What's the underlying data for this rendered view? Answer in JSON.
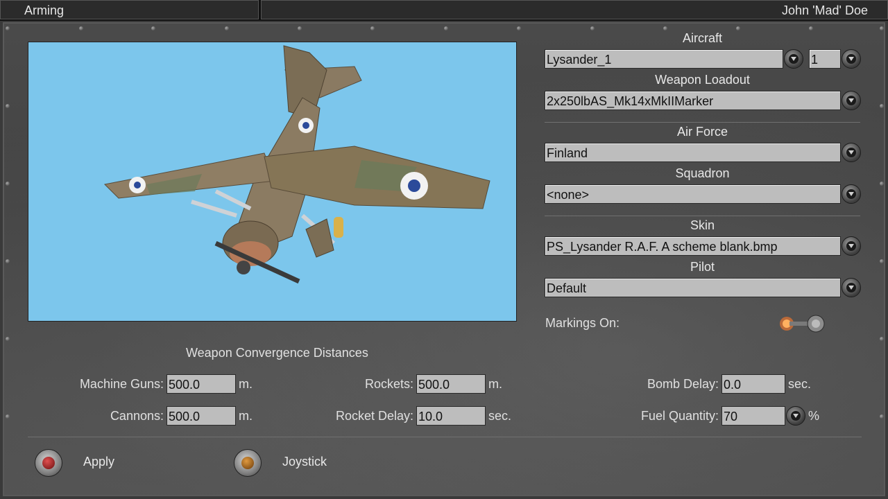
{
  "titlebar": {
    "title": "Arming",
    "user": "John 'Mad' Doe"
  },
  "aircraft": {
    "label": "Aircraft",
    "value": "Lysander_1",
    "count_value": "1"
  },
  "weapon_loadout": {
    "label": "Weapon Loadout",
    "value": "2x250lbAS_Mk14xMkIIMarker"
  },
  "air_force": {
    "label": "Air Force",
    "value": "Finland"
  },
  "squadron": {
    "label": "Squadron",
    "value": "<none>"
  },
  "skin": {
    "label": "Skin",
    "value": "PS_Lysander R.A.F. A scheme blank.bmp"
  },
  "pilot": {
    "label": "Pilot",
    "value": "Default"
  },
  "markings": {
    "label": "Markings On:",
    "state": "on"
  },
  "convergence": {
    "title": "Weapon Convergence Distances",
    "machine_guns": {
      "label": "Machine Guns:",
      "value": "500.0",
      "unit": "m."
    },
    "cannons": {
      "label": "Cannons:",
      "value": "500.0",
      "unit": "m."
    },
    "rockets": {
      "label": "Rockets:",
      "value": "500.0",
      "unit": "m."
    },
    "rocket_delay": {
      "label": "Rocket Delay:",
      "value": "10.0",
      "unit": "sec."
    },
    "bomb_delay": {
      "label": "Bomb Delay:",
      "value": "0.0",
      "unit": "sec."
    },
    "fuel_quantity": {
      "label": "Fuel Quantity:",
      "value": "70",
      "unit": "%"
    }
  },
  "buttons": {
    "apply": "Apply",
    "joystick": "Joystick"
  },
  "colors": {
    "preview_bg": "#7cc6ec",
    "field_bg": "#bdbdbd",
    "panel_bg": "#4a4a4a"
  }
}
